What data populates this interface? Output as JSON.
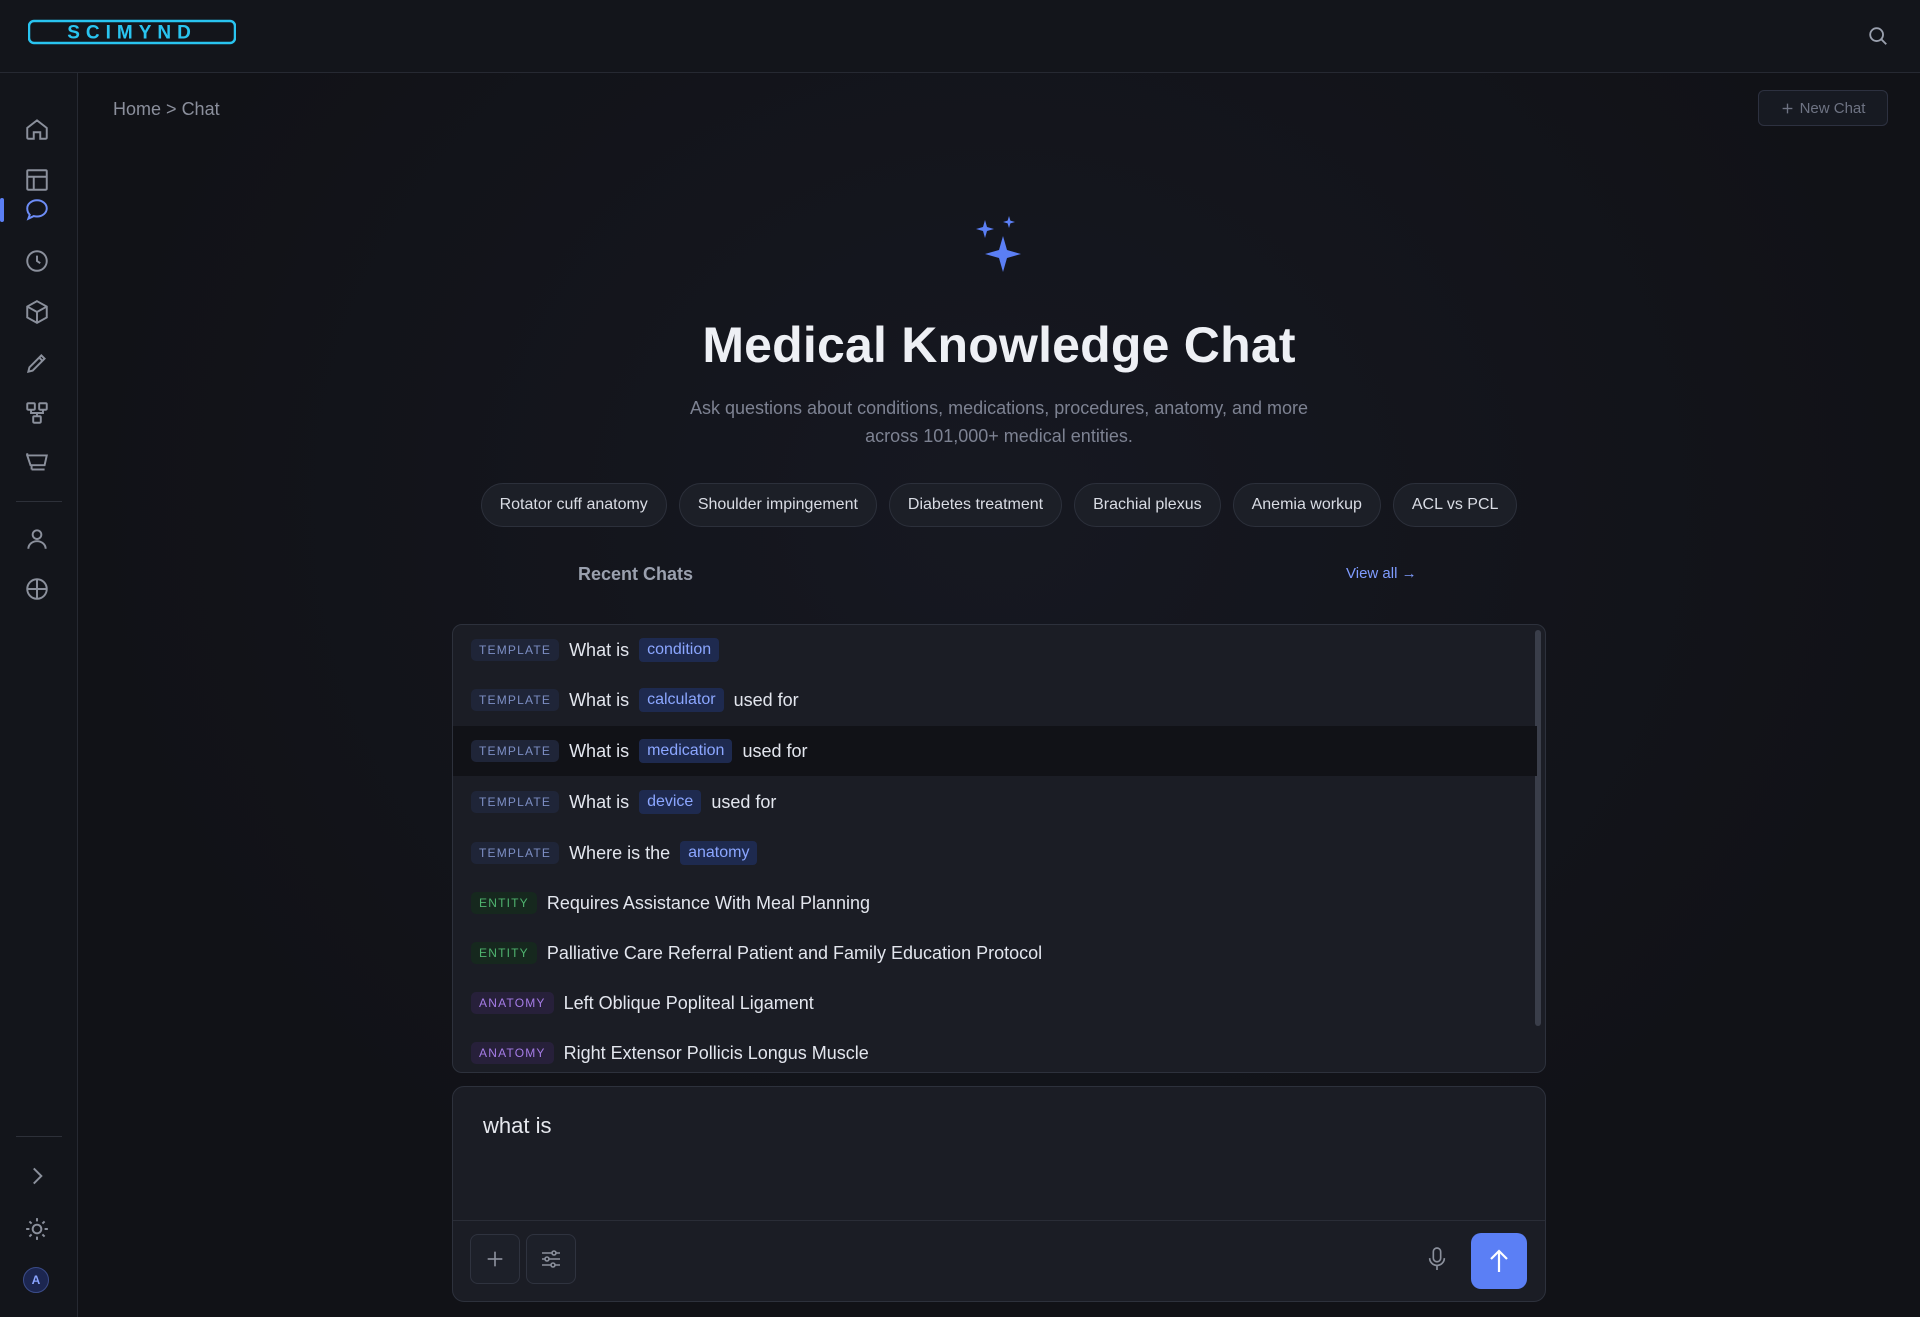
{
  "app": {
    "logo_text": "SCIMYND",
    "brand_color": "#29c4f0",
    "accent_color": "#5b7ff5"
  },
  "topbar": {
    "search_icon": "search-icon"
  },
  "sidebar": {
    "items": [
      {
        "name": "home",
        "icon": "home-icon"
      },
      {
        "name": "layout",
        "icon": "layout-icon"
      },
      {
        "name": "chat",
        "icon": "chat-icon",
        "active": true
      },
      {
        "name": "history",
        "icon": "clock-icon"
      },
      {
        "name": "models",
        "icon": "cube-icon"
      },
      {
        "name": "edit",
        "icon": "pencil-icon"
      },
      {
        "name": "workflow",
        "icon": "workflow-icon"
      },
      {
        "name": "store",
        "icon": "cart-icon"
      },
      {
        "name": "profile",
        "icon": "user-icon"
      },
      {
        "name": "network",
        "icon": "globe-icon"
      }
    ],
    "bottom": [
      {
        "name": "expand",
        "icon": "chevron-right-icon"
      },
      {
        "name": "theme",
        "icon": "sun-icon"
      }
    ],
    "avatar_initial": "A"
  },
  "breadcrumb": {
    "home": "Home",
    "separator": ">",
    "current": "Chat"
  },
  "new_chat": {
    "label": "New Chat"
  },
  "hero": {
    "title": "Medical Knowledge Chat",
    "subtitle_line1": "Ask questions about conditions, medications, procedures, anatomy, and more",
    "subtitle_line2": "across 101,000+ medical entities."
  },
  "chips": [
    "Rotator cuff anatomy",
    "Shoulder impingement",
    "Diabetes treatment",
    "Brachial plexus",
    "Anemia workup",
    "ACL vs PCL"
  ],
  "recent": {
    "title": "Recent Chats",
    "view_all": "View all →"
  },
  "suggestions": [
    {
      "type": "TEMPLATE",
      "before": "What is",
      "slot": "condition",
      "after": ""
    },
    {
      "type": "TEMPLATE",
      "before": "What is",
      "slot": "calculator",
      "after": "used for"
    },
    {
      "type": "TEMPLATE",
      "before": "What is",
      "slot": "medication",
      "after": "used for",
      "highlighted": true
    },
    {
      "type": "TEMPLATE",
      "before": "What is",
      "slot": "device",
      "after": "used for"
    },
    {
      "type": "TEMPLATE",
      "before": "Where is the",
      "slot": "anatomy",
      "after": ""
    },
    {
      "type": "ENTITY",
      "text": "Requires Assistance With Meal Planning"
    },
    {
      "type": "ENTITY",
      "text": "Palliative Care Referral Patient and Family Education Protocol"
    },
    {
      "type": "ANATOMY",
      "text": "Left Oblique Popliteal Ligament"
    },
    {
      "type": "ANATOMY",
      "text": "Right Extensor Pollicis Longus Muscle"
    }
  ],
  "composer": {
    "value": "what is"
  }
}
